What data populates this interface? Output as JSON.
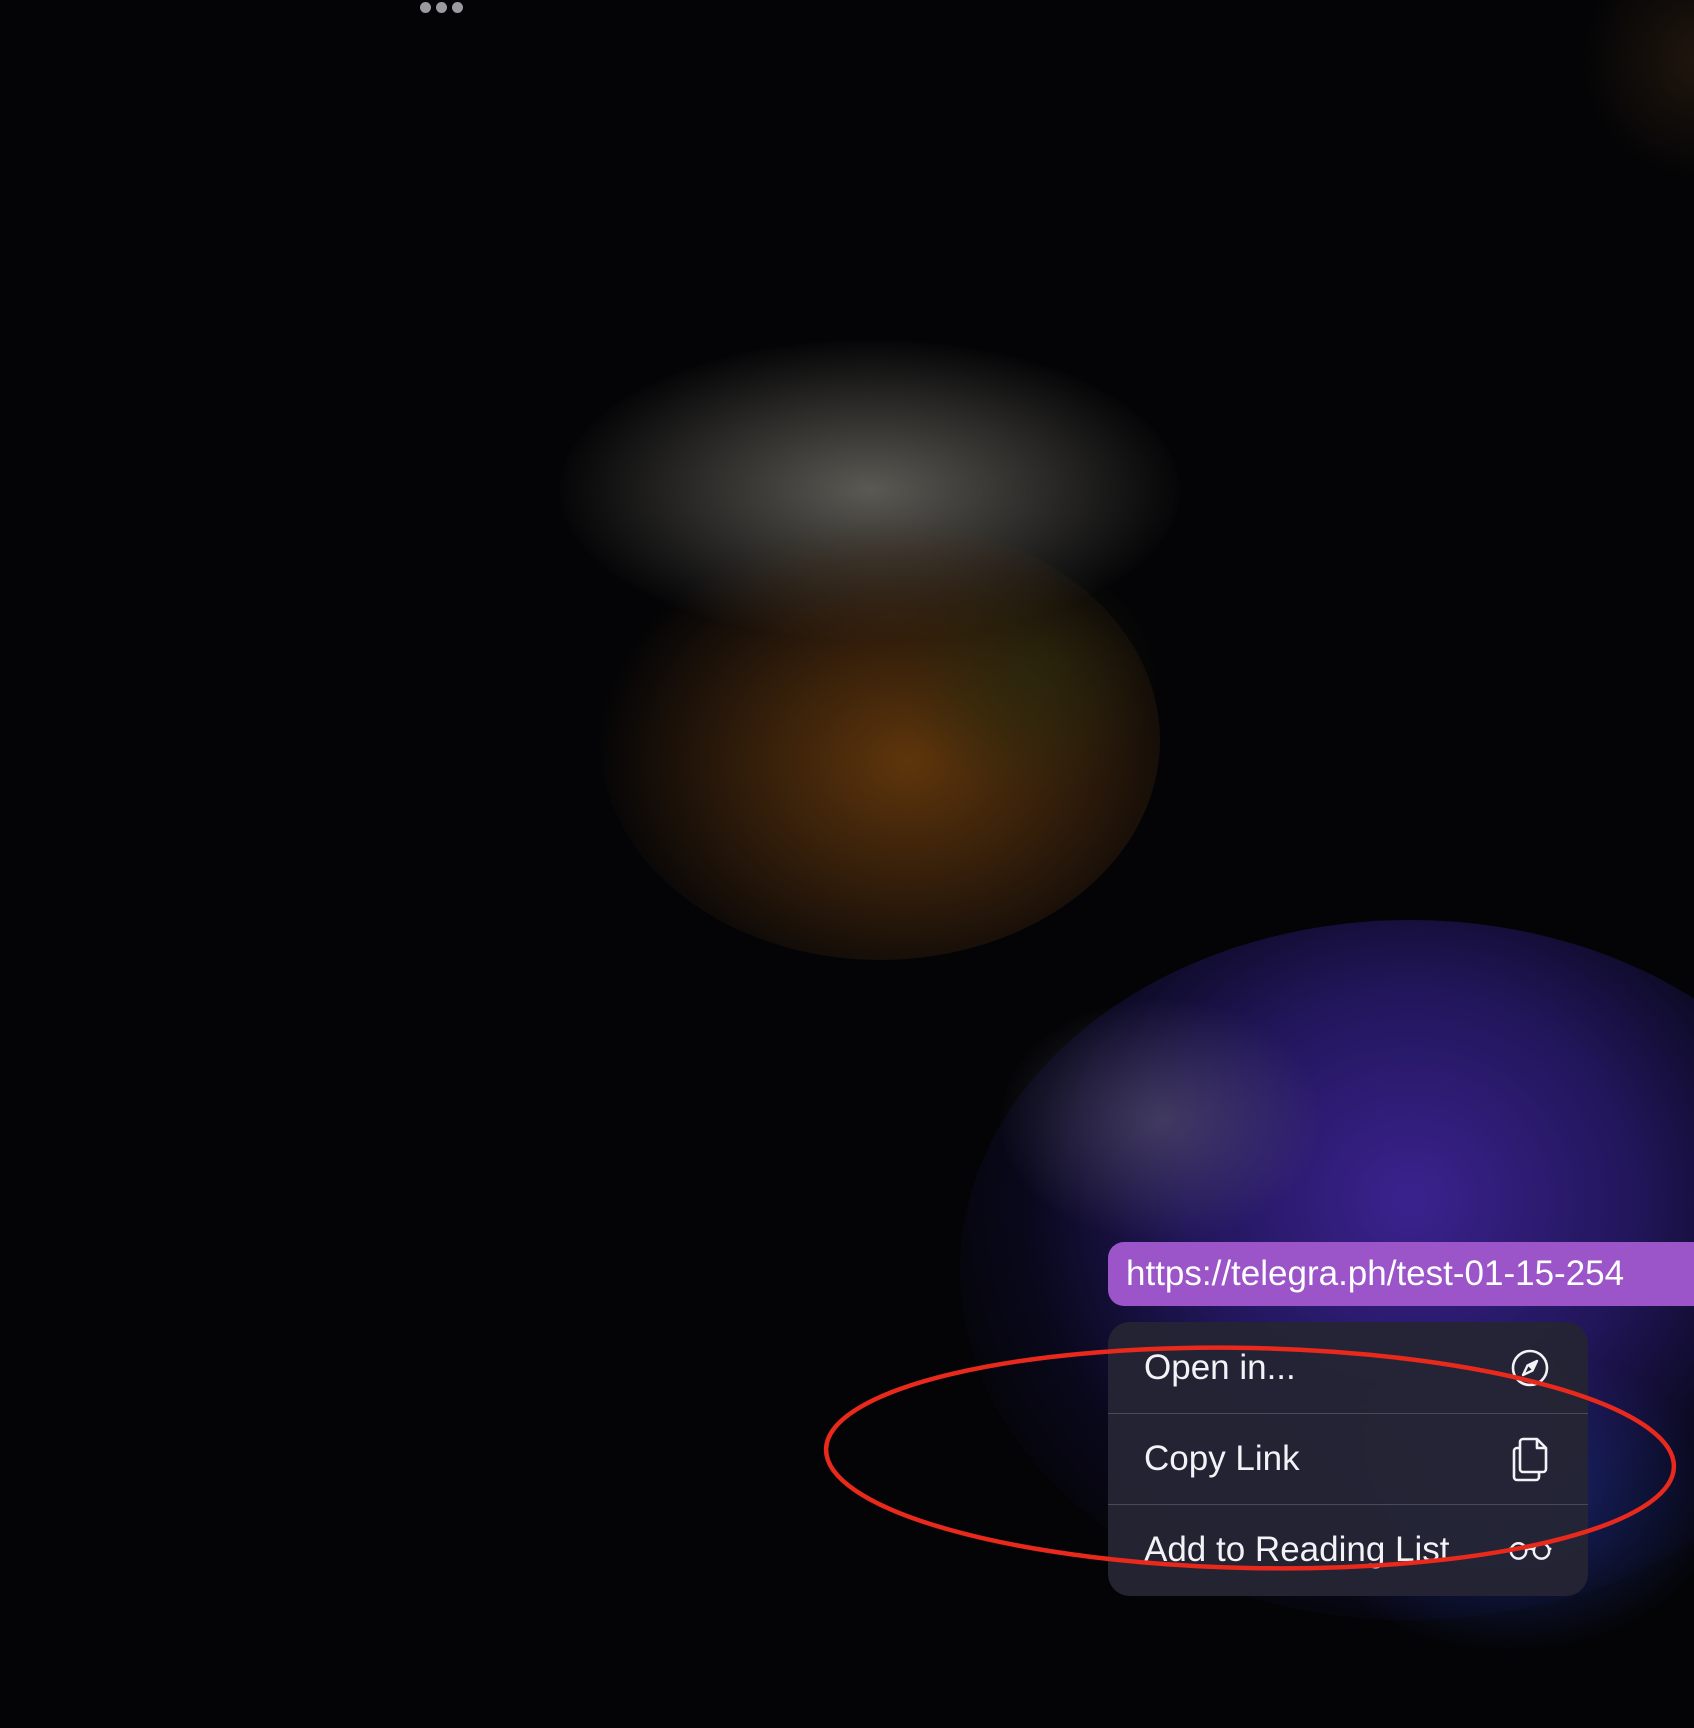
{
  "top_bar": {
    "more_icon": "ellipsis-icon"
  },
  "link_bubble": {
    "url": "https://telegra.ph/test-01-15-254",
    "color": "#9b55c9"
  },
  "context_menu": {
    "items": [
      {
        "label": "Open in...",
        "icon": "compass-icon"
      },
      {
        "label": "Copy Link",
        "icon": "copy-icon"
      },
      {
        "label": "Add to Reading List",
        "icon": "glasses-icon"
      }
    ]
  },
  "annotation": {
    "color": "#e8291c"
  }
}
